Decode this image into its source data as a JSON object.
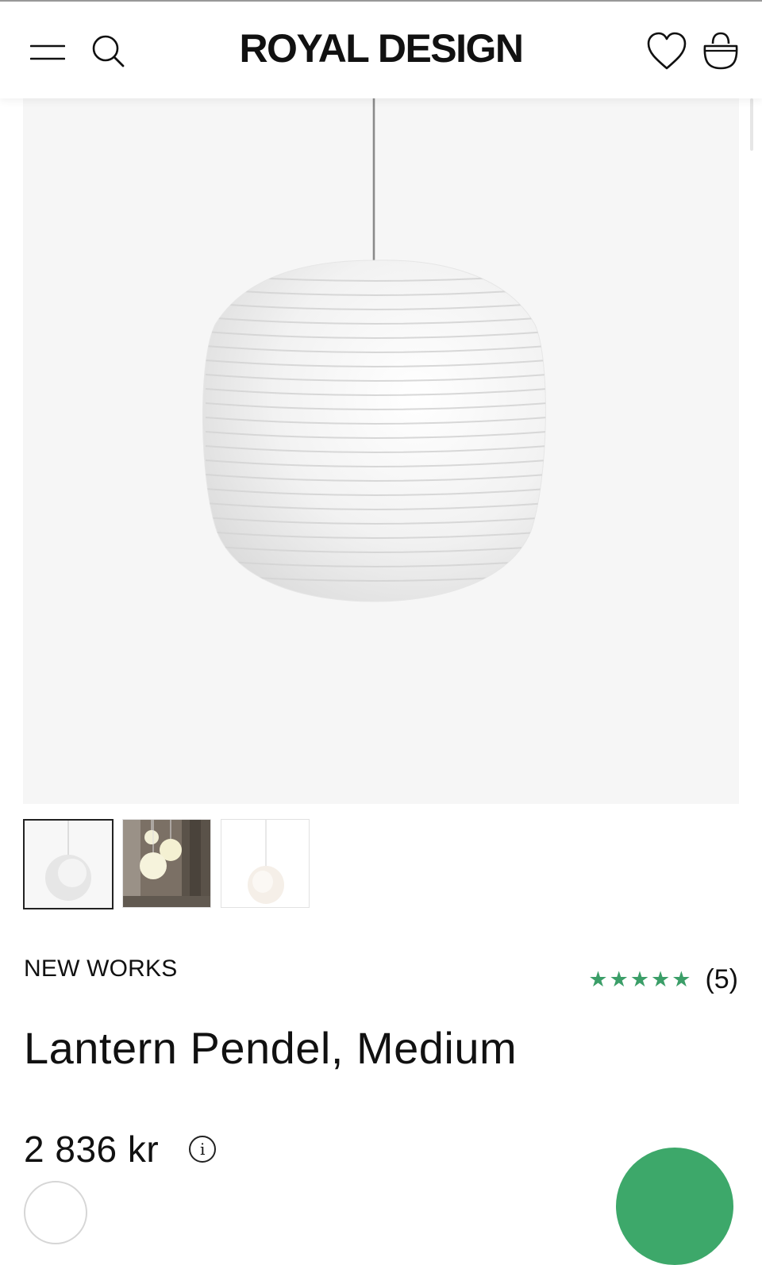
{
  "header": {
    "logo": "ROYAL DESIGN",
    "icons": [
      "hamburger-menu-icon",
      "search-icon",
      "heart-icon",
      "shopping-bag-icon"
    ]
  },
  "product": {
    "brand": "NEW WORKS",
    "title": "Lantern Pendel, Medium",
    "price": "2 836 kr",
    "rating": {
      "stars_text": "★★★★★",
      "value": 5,
      "max": 5,
      "count_text": "(5)"
    },
    "info_glyph": "i",
    "gallery": {
      "thumbnail_count": 3,
      "active_index": 0
    }
  },
  "colors": {
    "accent_green": "#3da86a",
    "star_green": "#3b9e68",
    "text": "#111111",
    "image_background": "#f6f6f6"
  }
}
